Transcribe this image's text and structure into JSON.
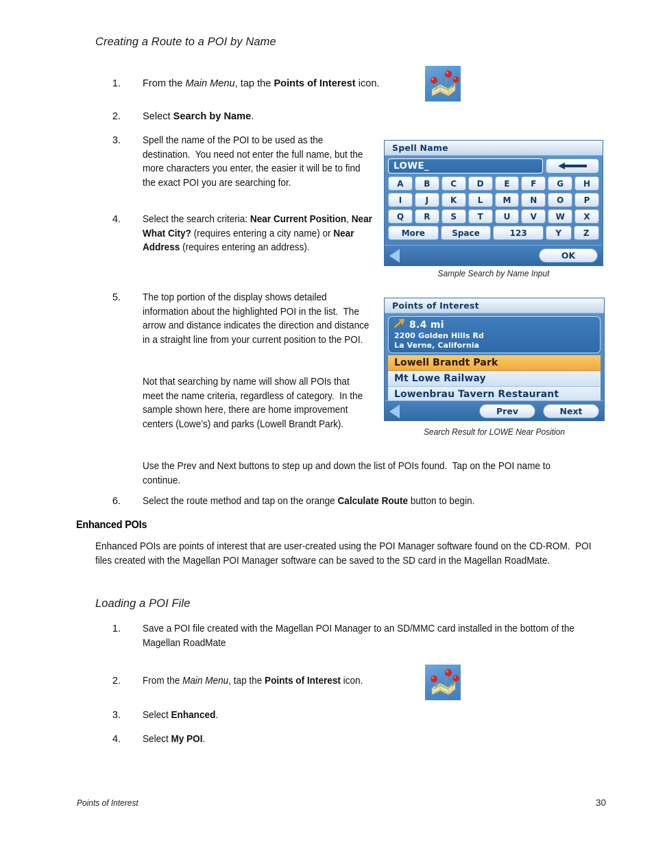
{
  "document": {
    "section_heading": "Creating a Route to a POI by Name",
    "steps": [
      {
        "number": "1.",
        "html": "From the <i>Main Menu</i>, tap the <b>Points of Interest</b> icon."
      },
      {
        "number": "2.",
        "html": "Select <b>Search by Name</b>."
      },
      {
        "number": "3.",
        "html": "Spell the name of the POI to be used as the destination.&nbsp; You need not enter the full name, but the more characters you enter, the easier it will be to find the exact POI you are searching for."
      },
      {
        "number": "4.",
        "html": "Select the search criteria: <b>Near Current Position</b>, <b>Near What City?</b> (requires entering a city name) or <b>Near Address</b> (requires entering an address)."
      },
      {
        "number": "5.",
        "html": "The top portion of the display shows detailed information about the highlighted POI in the list.&nbsp; The arrow and distance indicates the direction and distance in a straight line from your current position to the POI."
      },
      {
        "number": "6.",
        "html": "Select the route method and tap on the orange <b>Calculate Route</b> button to begin."
      }
    ],
    "step5_para2": "Not that searching by name will show all POIs that meet the name criteria, regardless of category.&nbsp; In the sample shown here, there are home improvement centers (Lowe&rsquo;s) and parks (Lowell Brandt Park).",
    "step5_para3": "Use the Prev and Next buttons to step up and down the list of POIs found.&nbsp; Tap on the POI name to continue.",
    "enhanced_heading": "Enhanced POIs",
    "enhanced_paragraph": "Enhanced POIs are points of interest that are user-created using the POI Manager software found on the CD-ROM.&nbsp; POI files created with the Magellan POI Manager software can be saved to the SD card in the Magellan RoadMate.",
    "loading_heading": "Loading a POI File",
    "loading_steps": [
      {
        "number": "1.",
        "html": "Save a POI file created with the Magellan POI Manager to an SD/MMC card installed in the bottom of the Magellan RoadMate"
      },
      {
        "number": "2.",
        "html": "From the <i>Main Menu</i>, tap the <b>Points of Interest</b> icon."
      },
      {
        "number": "3.",
        "html": "Select <b>Enhanced</b>."
      },
      {
        "number": "4.",
        "html": "Select <b>My POI</b>."
      }
    ],
    "captions": {
      "spell_name": "Sample Search by Name Input",
      "poi_list": "Search Result for LOWE Near Position"
    },
    "footer": {
      "left": "Points of Interest",
      "page_number": "30"
    },
    "icons": {
      "poi_map_icon": "points-of-interest-map-icon"
    }
  },
  "spell_name_screen": {
    "title": "Spell Name",
    "input_value": "LOWE_",
    "backspace_icon": "backspace-arrow-icon",
    "keyboard_rows": [
      [
        "A",
        "B",
        "C",
        "D",
        "E",
        "F",
        "G",
        "H"
      ],
      [
        "I",
        "J",
        "K",
        "L",
        "M",
        "N",
        "O",
        "P"
      ],
      [
        "Q",
        "R",
        "S",
        "T",
        "U",
        "V",
        "W",
        "X"
      ]
    ],
    "keyboard_last_row": [
      "More",
      "Space",
      "123",
      "Y",
      "Z"
    ],
    "back_icon": "back-triangle-icon",
    "ok_label": "OK"
  },
  "poi_list_screen": {
    "title": "Points of Interest",
    "detail": {
      "direction_icon": "direction-arrow-icon",
      "distance": "8.4 mi",
      "address_line1": "2200 Golden Hills Rd",
      "address_line2": "La Verne, California"
    },
    "rows": [
      {
        "label": "Lowell Brandt Park",
        "selected": true
      },
      {
        "label": "Mt Lowe Railway",
        "selected": false
      },
      {
        "label": "Lowenbrau Tavern Restaurant",
        "selected": false
      }
    ],
    "back_icon": "back-triangle-icon",
    "prev_label": "Prev",
    "next_label": "Next"
  },
  "theme": {
    "device_blue": "#4b84bf",
    "device_title_text": "#123a6b",
    "selected_row_orange": "#efab3c",
    "icon_background": "#4f8fce",
    "pin_red": "#cc1f1f"
  }
}
